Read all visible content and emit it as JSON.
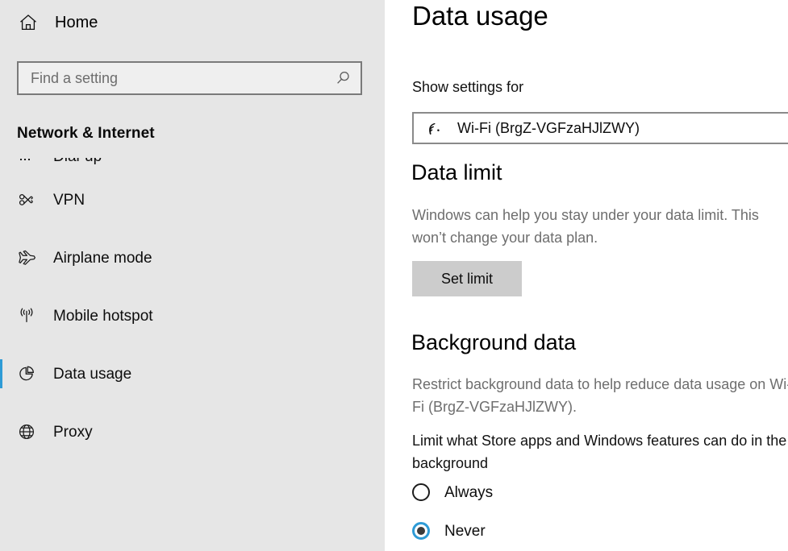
{
  "sidebar": {
    "home": {
      "label": "Home",
      "icon": "home-icon"
    },
    "search": {
      "value": "",
      "placeholder": "Find a setting",
      "icon": "search-icon"
    },
    "category": "Network & Internet",
    "items": [
      {
        "label": "Dial-up",
        "icon": "dial-up-icon",
        "selected": false
      },
      {
        "label": "VPN",
        "icon": "vpn-icon",
        "selected": false
      },
      {
        "label": "Airplane mode",
        "icon": "airplane-icon",
        "selected": false
      },
      {
        "label": "Mobile hotspot",
        "icon": "mobile-hotspot-icon",
        "selected": false
      },
      {
        "label": "Data usage",
        "icon": "pie-chart-icon",
        "selected": true
      },
      {
        "label": "Proxy",
        "icon": "globe-icon",
        "selected": false
      }
    ]
  },
  "content": {
    "title": "Data usage",
    "show_settings_for": {
      "label": "Show settings for",
      "selected": "Wi-Fi (BrgZ-VGFzaHJlZWY)",
      "icon": "wifi-icon"
    },
    "data_limit": {
      "heading": "Data limit",
      "description": "Windows can help you stay under your data limit. This\nwon’t change your data plan.",
      "button": "Set limit"
    },
    "background_data": {
      "heading": "Background data",
      "description": "Restrict background data to help reduce data usage on Wi-\nFi (BrgZ-VGFzaHJlZWY).",
      "question": "Limit what Store apps and Windows features can do in the\nbackground",
      "options": [
        {
          "label": "Always",
          "checked": false
        },
        {
          "label": "Never",
          "checked": true
        }
      ]
    }
  },
  "colors": {
    "accent": "#2e9bd6",
    "sidebar_bg": "#e6e6e6",
    "content_bg": "#ffffff",
    "button_bg": "#cccccc",
    "muted_text": "#6e6e6e"
  }
}
